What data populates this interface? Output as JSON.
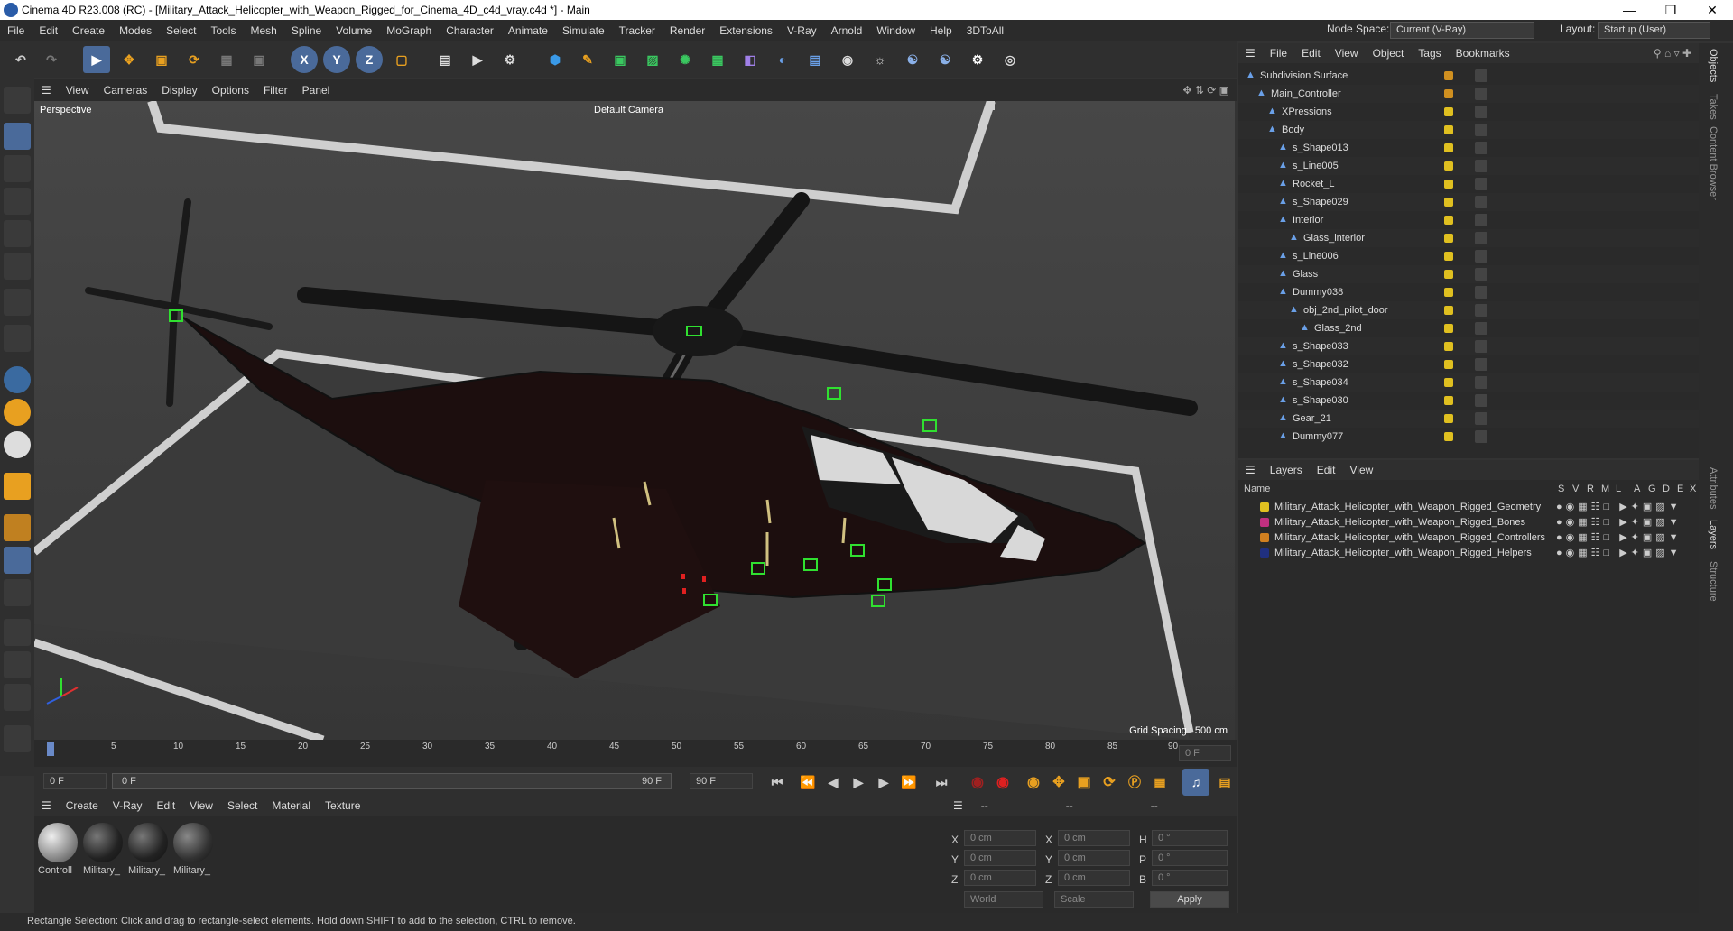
{
  "title": "Cinema 4D R23.008 (RC) - [Military_Attack_Helicopter_with_Weapon_Rigged_for_Cinema_4D_c4d_vray.c4d *] - Main",
  "menu": [
    "File",
    "Edit",
    "Create",
    "Modes",
    "Select",
    "Tools",
    "Mesh",
    "Spline",
    "Volume",
    "MoGraph",
    "Character",
    "Animate",
    "Simulate",
    "Tracker",
    "Render",
    "Extensions",
    "V-Ray",
    "Arnold",
    "Window",
    "Help",
    "3DToAll"
  ],
  "node_space_label": "Node Space:",
  "node_space_value": "Current (V-Ray)",
  "layout_label": "Layout:",
  "layout_value": "Startup (User)",
  "viewport": {
    "menu": [
      "View",
      "Cameras",
      "Display",
      "Options",
      "Filter",
      "Panel"
    ],
    "label": "Perspective",
    "camera": "Default Camera",
    "grid_spacing": "Grid Spacing : 500 cm"
  },
  "timeline": {
    "ticks": [
      "0",
      "5",
      "10",
      "15",
      "20",
      "25",
      "30",
      "35",
      "40",
      "45",
      "50",
      "55",
      "60",
      "65",
      "70",
      "75",
      "80",
      "85",
      "90"
    ],
    "current": "0 F",
    "start": "0 F",
    "slider_left": "0 F",
    "slider_right": "90 F",
    "end": "90 F"
  },
  "objects_menu": [
    "File",
    "Edit",
    "View",
    "Object",
    "Tags",
    "Bookmarks"
  ],
  "objects": [
    {
      "name": "Subdivision Surface",
      "indent": 0
    },
    {
      "name": "Main_Controller",
      "indent": 1
    },
    {
      "name": "XPressions",
      "indent": 2
    },
    {
      "name": "Body",
      "indent": 2
    },
    {
      "name": "s_Shape013",
      "indent": 3
    },
    {
      "name": "s_Line005",
      "indent": 3
    },
    {
      "name": "Rocket_L",
      "indent": 3
    },
    {
      "name": "s_Shape029",
      "indent": 3
    },
    {
      "name": "Interior",
      "indent": 3
    },
    {
      "name": "Glass_interior",
      "indent": 4
    },
    {
      "name": "s_Line006",
      "indent": 3
    },
    {
      "name": "Glass",
      "indent": 3
    },
    {
      "name": "Dummy038",
      "indent": 3
    },
    {
      "name": "obj_2nd_pilot_door",
      "indent": 4
    },
    {
      "name": "Glass_2nd",
      "indent": 5
    },
    {
      "name": "s_Shape033",
      "indent": 3
    },
    {
      "name": "s_Shape032",
      "indent": 3
    },
    {
      "name": "s_Shape034",
      "indent": 3
    },
    {
      "name": "s_Shape030",
      "indent": 3
    },
    {
      "name": "Gear_21",
      "indent": 3
    },
    {
      "name": "Dummy077",
      "indent": 3
    }
  ],
  "layers_menu": [
    "Layers",
    "Edit",
    "View"
  ],
  "layers_header": {
    "name": "Name",
    "cols": [
      "S",
      "V",
      "R",
      "M",
      "L",
      "A",
      "G",
      "D",
      "E",
      "X"
    ]
  },
  "layers": [
    {
      "name": "Military_Attack_Helicopter_with_Weapon_Rigged_Geometry",
      "color": "#e0c020"
    },
    {
      "name": "Military_Attack_Helicopter_with_Weapon_Rigged_Bones",
      "color": "#c03080"
    },
    {
      "name": "Military_Attack_Helicopter_with_Weapon_Rigged_Controllers",
      "color": "#d08020"
    },
    {
      "name": "Military_Attack_Helicopter_with_Weapon_Rigged_Helpers",
      "color": "#203080"
    }
  ],
  "material_menu": [
    "Create",
    "V-Ray",
    "Edit",
    "View",
    "Select",
    "Material",
    "Texture"
  ],
  "materials": [
    "Controll",
    "Military_",
    "Military_",
    "Military_"
  ],
  "coords": {
    "headers": [
      "--",
      "--",
      "--"
    ],
    "rows": [
      {
        "a": "X",
        "av": "0 cm",
        "b": "X",
        "bv": "0 cm",
        "c": "H",
        "cv": "0 °"
      },
      {
        "a": "Y",
        "av": "0 cm",
        "b": "Y",
        "bv": "0 cm",
        "c": "P",
        "cv": "0 °"
      },
      {
        "a": "Z",
        "av": "0 cm",
        "b": "Z",
        "bv": "0 cm",
        "c": "B",
        "cv": "0 °"
      }
    ],
    "mode1": "World",
    "mode2": "Scale",
    "apply": "Apply"
  },
  "side_tabs": [
    "Objects",
    "Takes",
    "Content Browser",
    "Attributes",
    "Layers",
    "Structure"
  ],
  "status": "Rectangle Selection: Click and drag to rectangle-select elements. Hold down SHIFT to add to the selection, CTRL to remove."
}
